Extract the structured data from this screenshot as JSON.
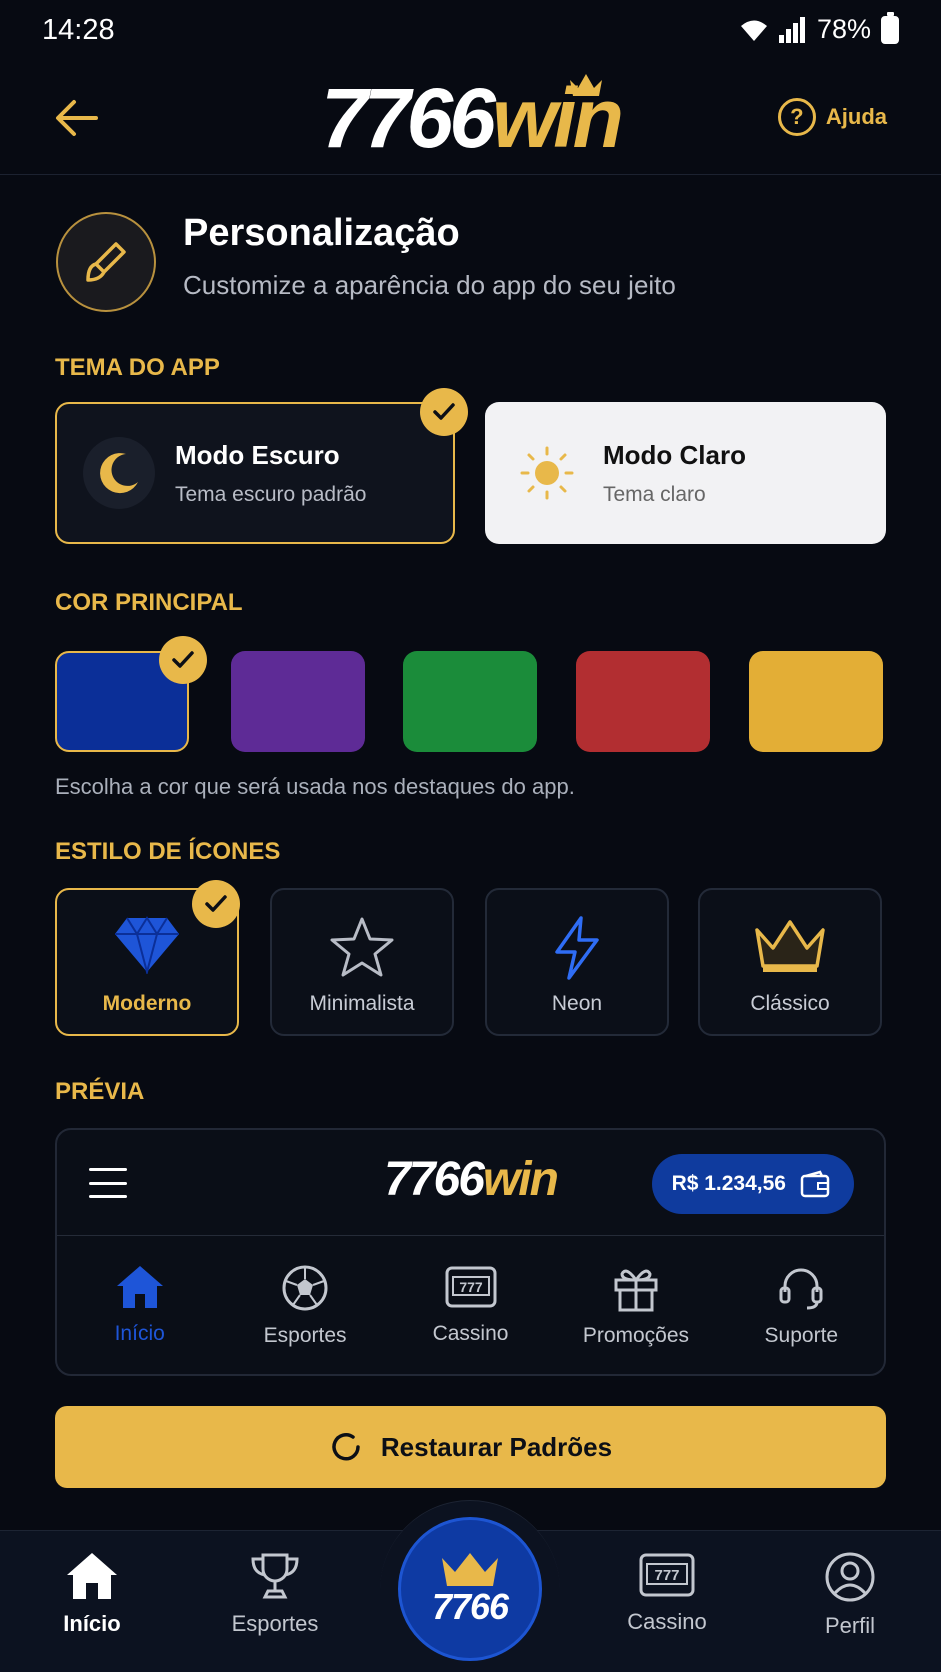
{
  "status_bar": {
    "time": "14:28",
    "battery": "78%"
  },
  "header": {
    "logo_num": "7766",
    "logo_win": "win",
    "help_label": "Ajuda"
  },
  "page": {
    "title": "Personalização",
    "subtitle": "Customize a aparência do app do seu jeito"
  },
  "theme": {
    "label": "TEMA DO APP",
    "options": [
      {
        "title": "Modo Escuro",
        "subtitle": "Tema escuro padrão",
        "selected": true
      },
      {
        "title": "Modo Claro",
        "subtitle": "Tema claro",
        "selected": false
      }
    ]
  },
  "main_color": {
    "label": "COR PRINCIPAL",
    "colors": [
      "#0b2f98",
      "#5e2b96",
      "#1b8c3a",
      "#b22e31",
      "#e3ae36"
    ],
    "selected_index": 0,
    "note": "Escolha a cor que será usada nos destaques do app."
  },
  "icon_style": {
    "label": "ESTILO DE ÍCONES",
    "options": [
      {
        "label": "Moderno",
        "icon": "diamond-icon",
        "selected": true
      },
      {
        "label": "Minimalista",
        "icon": "star-icon",
        "selected": false
      },
      {
        "label": "Neon",
        "icon": "lightning-icon",
        "selected": false
      },
      {
        "label": "Clássico",
        "icon": "crown-icon",
        "selected": false
      }
    ]
  },
  "preview": {
    "label": "PRÉVIA",
    "logo_num": "7766",
    "logo_win": "win",
    "balance": "R$ 1.234,56",
    "nav": [
      {
        "label": "Início",
        "icon": "home-icon",
        "active": true
      },
      {
        "label": "Esportes",
        "icon": "soccer-ball-icon",
        "active": false
      },
      {
        "label": "Cassino",
        "icon": "slot-machine-icon",
        "active": false
      },
      {
        "label": "Promoções",
        "icon": "gift-icon",
        "active": false
      },
      {
        "label": "Suporte",
        "icon": "headset-icon",
        "active": false
      }
    ]
  },
  "restore_button": {
    "label": "Restaurar Padrões"
  },
  "bottom_nav": {
    "items": [
      {
        "label": "Início",
        "icon": "home-icon",
        "active": true
      },
      {
        "label": "Esportes",
        "icon": "trophy-icon",
        "active": false
      },
      {
        "label": "Cassino",
        "icon": "slot-machine-icon",
        "active": false
      },
      {
        "label": "Perfil",
        "icon": "user-icon",
        "active": false
      }
    ],
    "center_label": "7766"
  },
  "colors": {
    "accent_gold": "#e8b84a",
    "accent_blue": "#1e55d8",
    "background": "#070a12"
  }
}
